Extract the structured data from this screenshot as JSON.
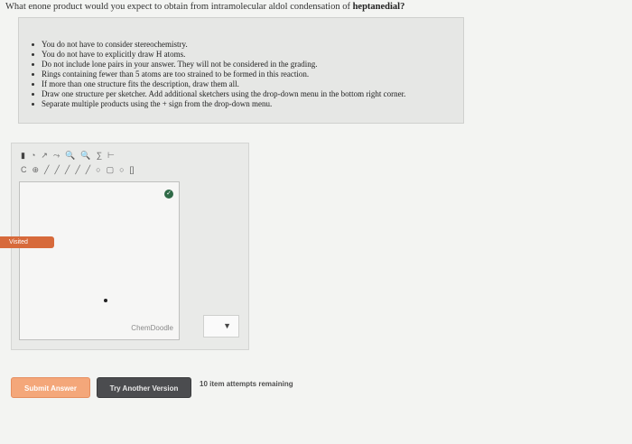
{
  "question": {
    "prefix": "What enone product would you expect to obtain from intramolecular aldol condensation of ",
    "compound": "heptanedial?"
  },
  "instructions": [
    "You do not have to consider stereochemistry.",
    "You do not have to explicitly draw H atoms.",
    "Do not include lone pairs in your answer. They will not be considered in the grading.",
    "Rings containing fewer than 5 atoms are too strained to be formed in this reaction.",
    "If more than one structure fits the description, draw them all.",
    "Draw one structure per sketcher. Add additional sketchers using the drop-down menu in the bottom right corner.",
    "Separate multiple products using the + sign from the drop-down menu."
  ],
  "toolbar": {
    "row1": [
      "▮",
      "◔",
      "↗",
      "⤳",
      "🔍",
      "🔍",
      "∑",
      "⊢"
    ],
    "row2": [
      "C",
      "⊕",
      "╱",
      "╱",
      "╱",
      "╱",
      "╱",
      "○",
      "▢",
      "○",
      "[]"
    ]
  },
  "sketcher": {
    "brand": "ChemDoodle",
    "dropdown_caret": "▼"
  },
  "visited_label": "Visited",
  "buttons": {
    "submit": "Submit Answer",
    "try_another": "Try Another Version"
  },
  "attempts": "10 item attempts remaining"
}
